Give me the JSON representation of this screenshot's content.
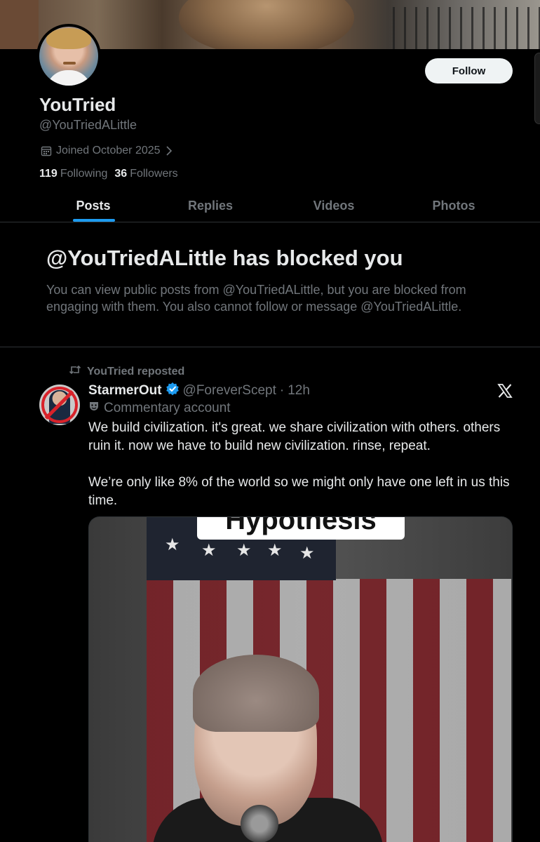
{
  "profile": {
    "display_name": "YouTried",
    "handle": "@YouTriedALittle",
    "joined": "Joined October 2025",
    "following_count": "119",
    "following_label": "Following",
    "followers_count": "36",
    "followers_label": "Followers",
    "follow_label": "Follow"
  },
  "tabs": [
    {
      "label": "Posts",
      "active": true
    },
    {
      "label": "Replies",
      "active": false
    },
    {
      "label": "Videos",
      "active": false
    },
    {
      "label": "Photos",
      "active": false
    }
  ],
  "blocked": {
    "title": "@YouTriedALittle has blocked you",
    "description": "You can view public posts from @YouTriedALittle, but you are blocked from engaging with them. You also cannot follow or message @YouTriedALittle."
  },
  "post": {
    "repost_label": "YouTried reposted",
    "author_name": "StarmerOut",
    "author_handle": "@ForeverScept",
    "separator": "·",
    "time": "12h",
    "account_label": "Commentary account",
    "text_1": "We build civilization. it's great. we share civilization with others. others ruin it. now we have to build new civilization. rinse, repeat.",
    "text_2": "We’re only like 8% of the world so we might only have one left in us this time.",
    "media_caption": "Hypothesis"
  },
  "colors": {
    "background": "#000000",
    "text_primary": "#e7e9ea",
    "text_secondary": "#71767b",
    "accent_blue": "#1d9bf0",
    "divider": "#2f3336"
  }
}
